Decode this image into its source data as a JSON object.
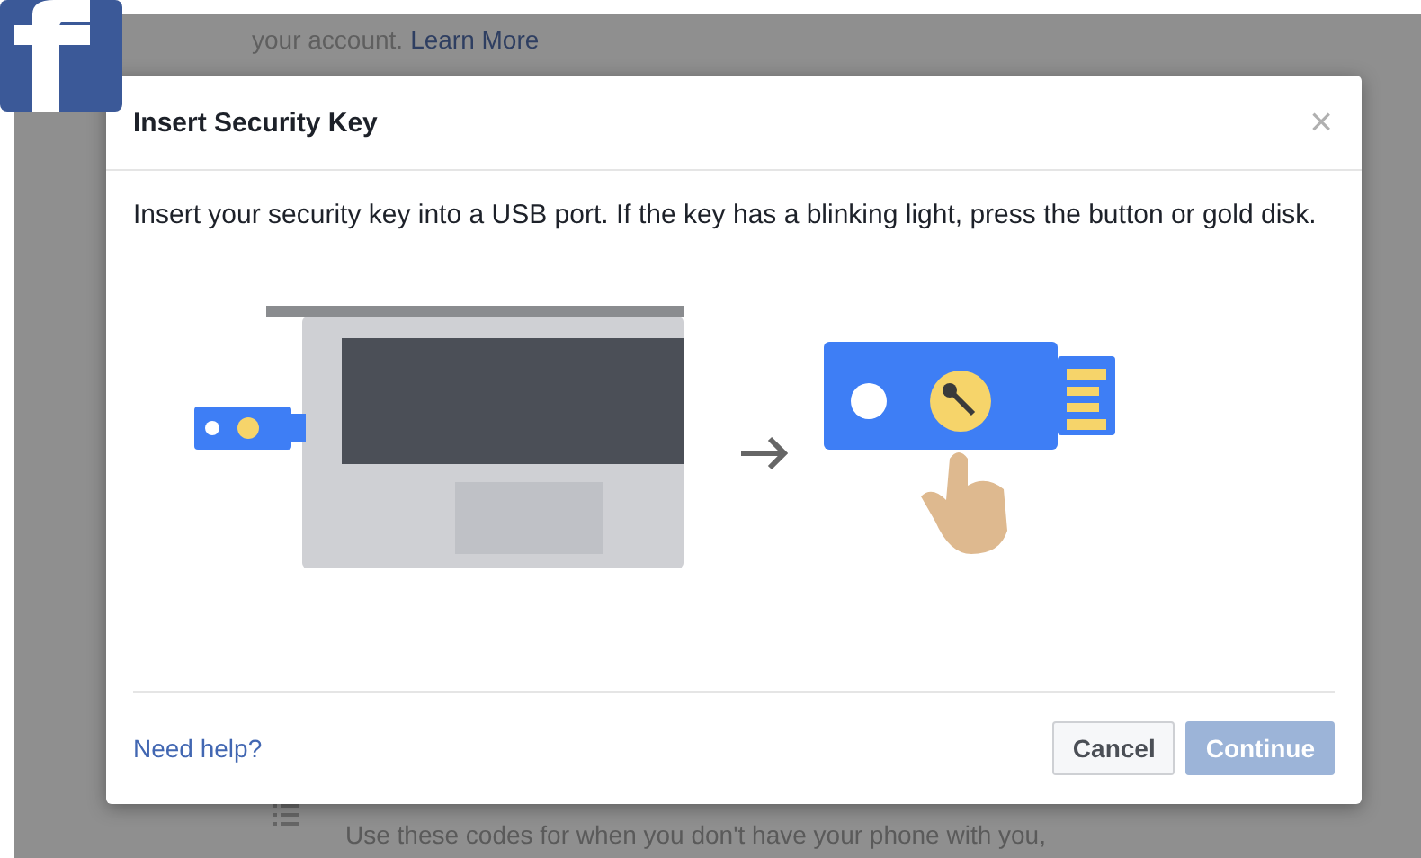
{
  "background_page": {
    "intro_text": "your account.",
    "intro_link": "Learn More",
    "codes_text": "Use these codes for when you don't have your phone with you,"
  },
  "dialog": {
    "title": "Insert Security Key",
    "close": "×",
    "message": "Insert your security key into a USB port. If the key has a blinking light, press the button or gold disk.",
    "help_link": "Need help?",
    "buttons": [
      {
        "label": "Cancel",
        "kind": "secondary",
        "disabled": false
      },
      {
        "label": "Continue",
        "kind": "primary",
        "disabled": true
      }
    ]
  }
}
